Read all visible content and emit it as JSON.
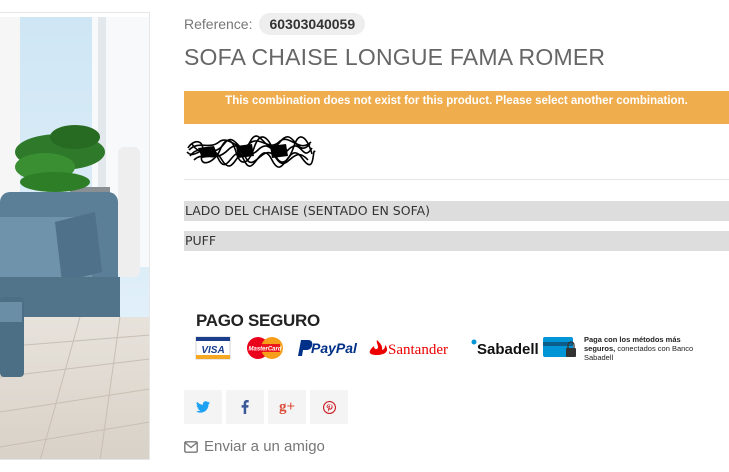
{
  "product": {
    "reference_label": "Reference:",
    "reference_value": "60303040059",
    "title": "SOFA CHAISE LONGUE FAMA ROMER",
    "alert": "This combination does not exist for this product. Please select another combination."
  },
  "attributes": [
    {
      "label": "LADO DEL CHAISE (SENTADO EN SOFA)"
    },
    {
      "label": "PUFF"
    }
  ],
  "payment": {
    "title": "PAGO SEGURO",
    "logos": [
      "VISA",
      "MasterCard",
      "PayPal",
      "Santander",
      "Sabadell"
    ],
    "note_bold": "Paga con los métodos más seguros,",
    "note_rest": "conectados con Banco Sabadell"
  },
  "share": {
    "buttons": [
      "twitter-icon",
      "facebook-icon",
      "google-plus-icon",
      "pinterest-icon"
    ],
    "send_friend": "Enviar a un amigo"
  },
  "colors": {
    "alert_bg": "#f0ad4e",
    "attr_bg": "#dddddd",
    "twitter": "#1da1f2",
    "facebook": "#3b5998",
    "gplus": "#dd4b39",
    "pinterest": "#cb2027"
  }
}
